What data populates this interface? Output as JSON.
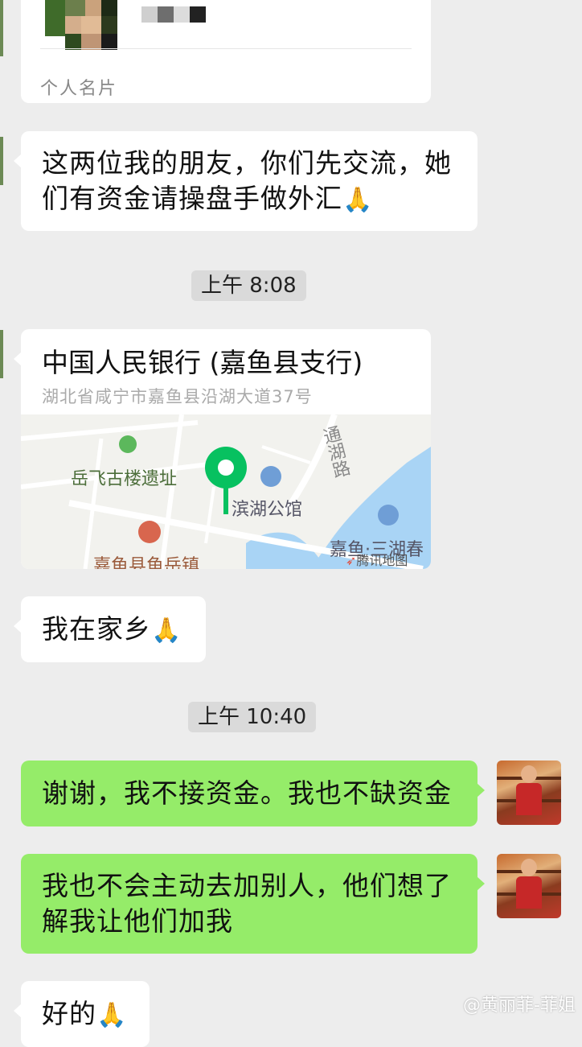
{
  "contact_card": {
    "footer": "个人名片"
  },
  "messages": {
    "m1": {
      "text": "这两位我的朋友，你们先交流，她们有资金请操盘手做外汇",
      "emoji": "🙏"
    },
    "time1": "上午 8:08",
    "location": {
      "title": "中国人民银行 (嘉鱼县支行)",
      "address": "湖北省咸宁市嘉鱼县沿湖大道37号",
      "map_labels": {
        "poi1": "岳飞古楼遗址",
        "poi2": "滨湖公馆",
        "road": "通湖路",
        "poi3": "嘉鱼县鱼岳镇",
        "poi4": "嘉鱼·三湖春",
        "brand": "腾讯地图"
      }
    },
    "m2": {
      "text": "我在家乡",
      "emoji": "🙏"
    },
    "time2": "上午 10:40",
    "m3": {
      "text": "谢谢，我不接资金。我也不缺资金"
    },
    "m4": {
      "text": "我也不会主动去加别人，他们想了解我让他们加我"
    },
    "m5": {
      "text": "好的",
      "emoji": "🙏"
    }
  },
  "watermark": "@黄丽菲-菲姐",
  "colors": {
    "background": "#ededed",
    "bubble_incoming": "#ffffff",
    "bubble_outgoing": "#95ec69",
    "map_pin": "#07c160"
  }
}
